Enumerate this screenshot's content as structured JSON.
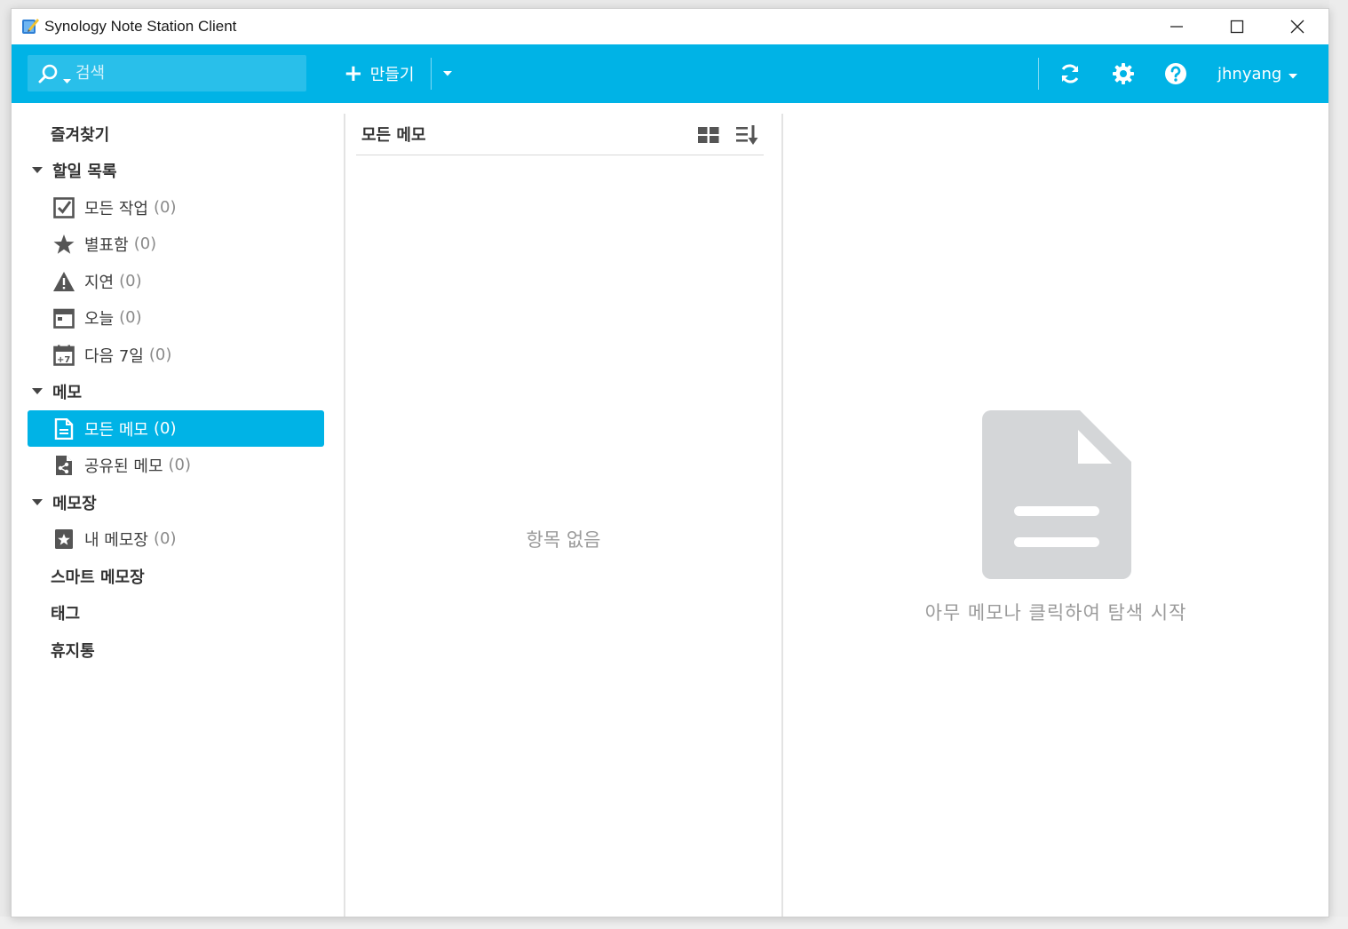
{
  "window": {
    "title": "Synology Note Station Client"
  },
  "toolbar": {
    "search_placeholder": "검색",
    "create_label": "만들기",
    "user_name": "jhnyang",
    "accent_color": "#00b3e6"
  },
  "sidebar": {
    "favorites": "즐겨찾기",
    "todo_group": "할일 목록",
    "todo_items": [
      {
        "label": "모든 작업",
        "count": "(0)",
        "icon": "checkbox-icon"
      },
      {
        "label": "별표함",
        "count": "(0)",
        "icon": "star-icon"
      },
      {
        "label": "지연",
        "count": "(0)",
        "icon": "warning-icon"
      },
      {
        "label": "오늘",
        "count": "(0)",
        "icon": "calendar-icon"
      },
      {
        "label": "다음 7일",
        "count": "(0)",
        "icon": "calendar-plus7-icon"
      }
    ],
    "memo_group": "메모",
    "memo_items": [
      {
        "label": "모든 메모",
        "count": "(0)",
        "icon": "note-icon",
        "active": true
      },
      {
        "label": "공유된 메모",
        "count": "(0)",
        "icon": "shared-note-icon"
      }
    ],
    "notebook_group": "메모장",
    "notebook_items": [
      {
        "label": "내 메모장",
        "count": "(0)",
        "icon": "notebook-star-icon"
      }
    ],
    "smart_notebooks": "스마트 메모장",
    "tags": "태그",
    "trash": "휴지통"
  },
  "list": {
    "title": "모든 메모",
    "empty_text": "항목 없음"
  },
  "preview": {
    "hint": "아무 메모나 클릭하여 탐색 시작"
  }
}
